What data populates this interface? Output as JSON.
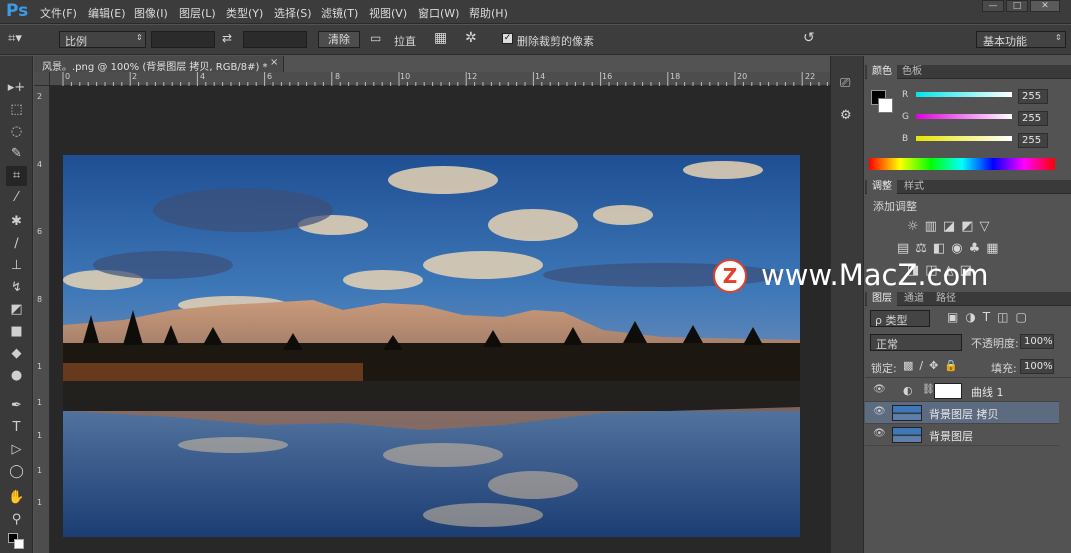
{
  "app": {
    "logo": "Ps"
  },
  "menu": [
    "文件(F)",
    "编辑(E)",
    "图像(I)",
    "图层(L)",
    "类型(Y)",
    "选择(S)",
    "滤镜(T)",
    "视图(V)",
    "窗口(W)",
    "帮助(H)"
  ],
  "window_buttons": [
    "—",
    "□",
    "✕"
  ],
  "options": {
    "ratio": "比例",
    "clear": "清除",
    "straighten": "拉直",
    "delete_crop": "删除裁剪的像素",
    "workspace": "基本功能"
  },
  "doc_tab": {
    "title": "风景。.png @ 100% (背景图层 拷贝, RGB/8#) *",
    "close": "×"
  },
  "ruler_h": [
    "0",
    "2",
    "4",
    "6",
    "8",
    "10",
    "12",
    "14",
    "16",
    "18",
    "20",
    "22"
  ],
  "ruler_v": [
    "2",
    "4",
    "6",
    "8",
    "1",
    "1",
    "1",
    "1",
    "1"
  ],
  "color_panel": {
    "tabs": [
      "颜色",
      "色板"
    ],
    "channels": [
      {
        "label": "R",
        "value": "255",
        "color": "#00e5e5"
      },
      {
        "label": "G",
        "value": "255",
        "color": "#e000e0"
      },
      {
        "label": "B",
        "value": "255",
        "color": "#e5e500"
      }
    ]
  },
  "adjust_panel": {
    "tabs": [
      "调整",
      "样式"
    ],
    "title": "添加调整"
  },
  "layers_panel": {
    "tabs": [
      "图层",
      "通道",
      "路径"
    ],
    "kind": "ρ 类型",
    "blend": "正常",
    "opacity_label": "不透明度:",
    "opacity": "100%",
    "lock_label": "锁定:",
    "fill_label": "填充:",
    "fill": "100%",
    "layers": [
      {
        "name": "曲线 1",
        "selected": false
      },
      {
        "name": "背景图层 拷贝",
        "selected": true
      },
      {
        "name": "背景图层",
        "selected": false
      }
    ]
  },
  "watermark": {
    "badge": "Z",
    "text": "www.MacZ.com"
  }
}
